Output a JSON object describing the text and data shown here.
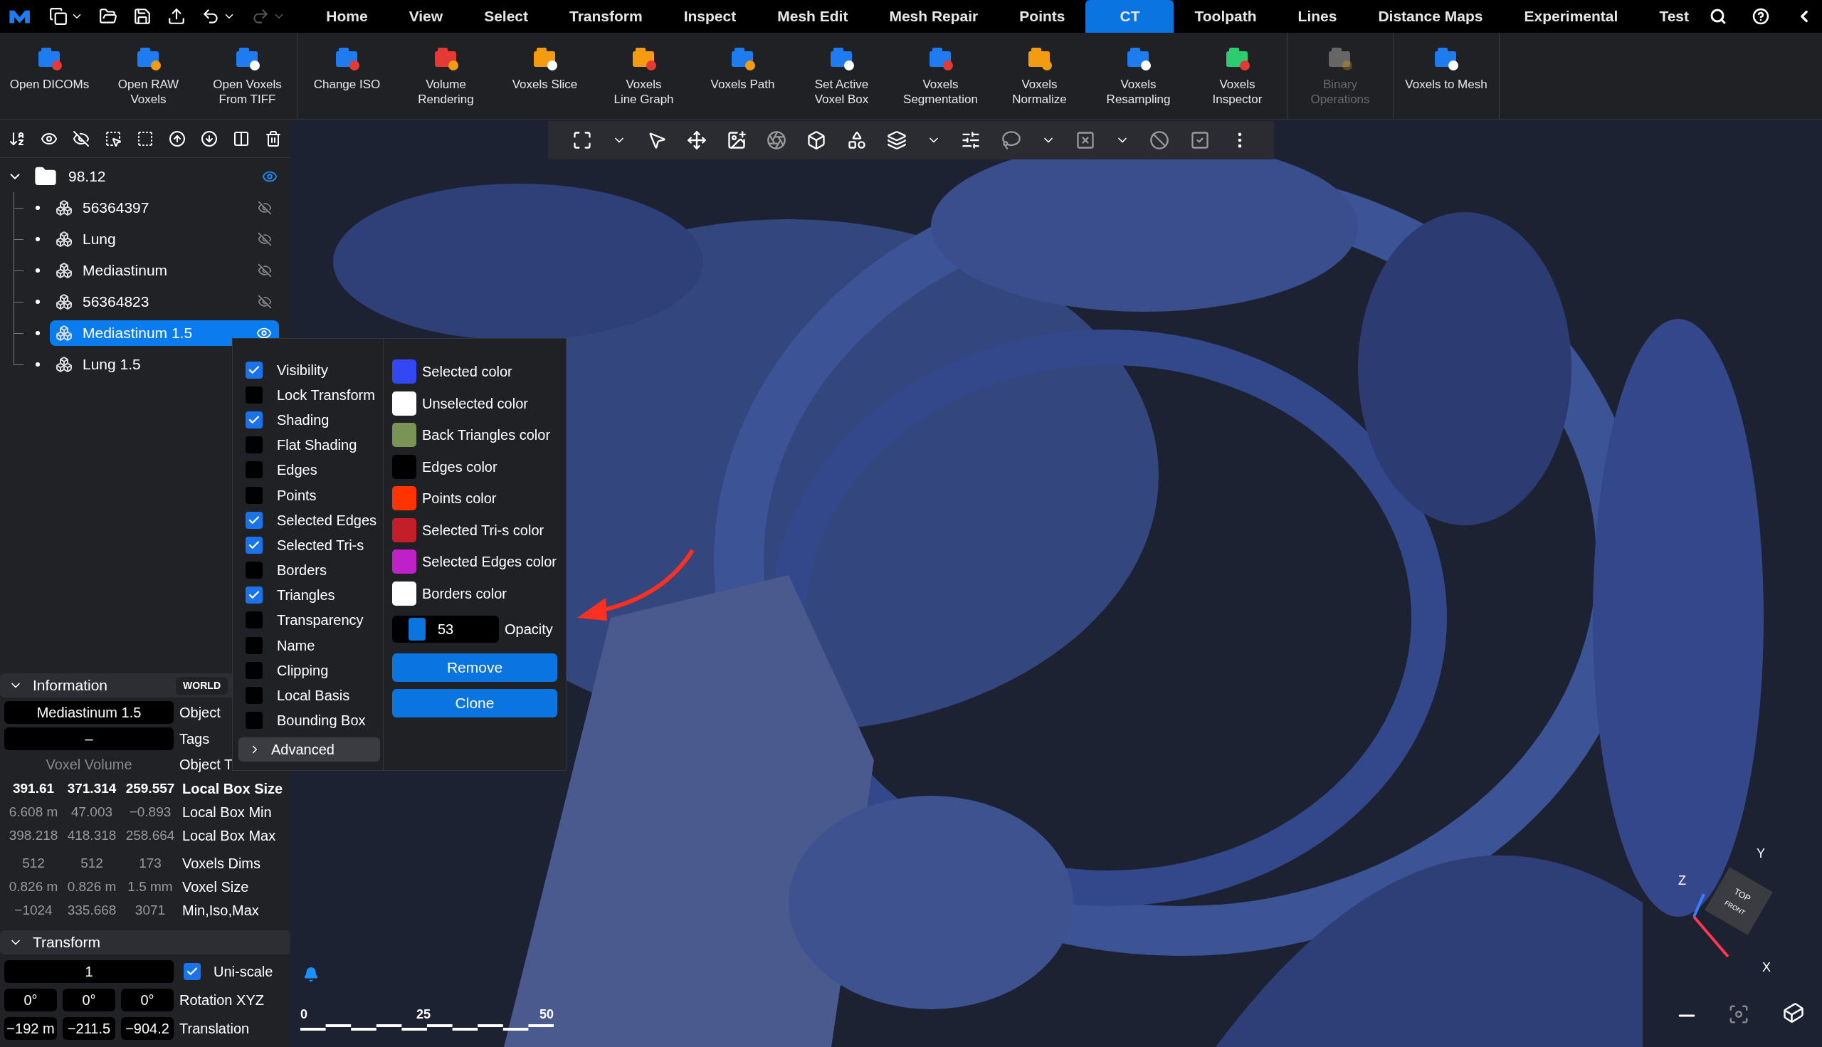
{
  "menu_bar": {
    "tabs": [
      {
        "label": "Home",
        "selected": false
      },
      {
        "label": "View",
        "selected": false
      },
      {
        "label": "Select",
        "selected": false
      },
      {
        "label": "Transform",
        "selected": false
      },
      {
        "label": "Inspect",
        "selected": false
      },
      {
        "label": "Mesh Edit",
        "selected": false
      },
      {
        "label": "Mesh Repair",
        "selected": false
      },
      {
        "label": "Points",
        "selected": false
      },
      {
        "label": "CT",
        "selected": true
      },
      {
        "label": "Toolpath",
        "selected": false
      },
      {
        "label": "Lines",
        "selected": false
      },
      {
        "label": "Distance Maps",
        "selected": false
      },
      {
        "label": "Experimental",
        "selected": false
      },
      {
        "label": "Test",
        "selected": false
      }
    ]
  },
  "ribbon": {
    "groups": [
      [
        {
          "label": "Open DICOMs",
          "disabled": false
        },
        {
          "label": "Open RAW\nVoxels",
          "disabled": false
        },
        {
          "label": "Open Voxels\nFrom TIFF",
          "disabled": false
        }
      ],
      [
        {
          "label": "Change ISO",
          "disabled": false
        },
        {
          "label": "Volume\nRendering",
          "disabled": false
        },
        {
          "label": "Voxels Slice",
          "disabled": false
        },
        {
          "label": "Voxels\nLine Graph",
          "disabled": false
        },
        {
          "label": "Voxels Path",
          "disabled": false
        },
        {
          "label": "Set Active\nVoxel Box",
          "disabled": false
        },
        {
          "label": "Voxels\nSegmentation",
          "disabled": false
        },
        {
          "label": "Voxels\nNormalize",
          "disabled": false
        },
        {
          "label": "Voxels\nResampling",
          "disabled": false
        },
        {
          "label": "Voxels\nInspector",
          "disabled": false
        }
      ],
      [
        {
          "label": "Binary\nOperations",
          "disabled": true
        }
      ],
      [
        {
          "label": "Voxels to Mesh",
          "disabled": false
        }
      ]
    ]
  },
  "scene_tree": {
    "label": "98.12",
    "expanded": true,
    "visible": true,
    "children": [
      {
        "label": "56364397",
        "visible": false,
        "selected": false
      },
      {
        "label": "Lung",
        "visible": false,
        "selected": false
      },
      {
        "label": "Mediastinum",
        "visible": false,
        "selected": false
      },
      {
        "label": "56364823",
        "visible": false,
        "selected": false
      },
      {
        "label": "Mediastinum 1.5",
        "visible": true,
        "selected": true
      },
      {
        "label": "Lung 1.5",
        "selected": false
      }
    ]
  },
  "context_menu": {
    "toggles": [
      {
        "label": "Visibility",
        "checked": true
      },
      {
        "label": "Lock Transform",
        "checked": false
      },
      {
        "label": "Shading",
        "checked": true
      },
      {
        "label": "Flat Shading",
        "checked": false
      },
      {
        "label": "Edges",
        "checked": false
      },
      {
        "label": "Points",
        "checked": false
      },
      {
        "label": "Selected Edges",
        "checked": true
      },
      {
        "label": "Selected Tri-s",
        "checked": true
      },
      {
        "label": "Borders",
        "checked": false
      },
      {
        "label": "Triangles",
        "checked": true
      },
      {
        "label": "Transparency",
        "checked": false
      },
      {
        "label": "Name",
        "checked": false
      },
      {
        "label": "Clipping",
        "checked": false
      },
      {
        "label": "Local Basis",
        "checked": false
      },
      {
        "label": "Bounding Box",
        "checked": false
      }
    ],
    "advanced": {
      "label": "Advanced",
      "expanded": false
    },
    "colors": [
      {
        "label": "Selected color",
        "color": "#3447f5"
      },
      {
        "label": "Unselected color",
        "color": "#ffffff"
      },
      {
        "label": "Back Triangles color",
        "color": "#7a9456"
      },
      {
        "label": "Edges color",
        "color": "#000000"
      },
      {
        "label": "Points color",
        "color": "#ff3300"
      },
      {
        "label": "Selected Tri-s color",
        "color": "#c41e2a"
      },
      {
        "label": "Selected Edges color",
        "color": "#c020c8"
      },
      {
        "label": "Borders color",
        "color": "#ffffff"
      }
    ],
    "opacity": {
      "value": "53",
      "label": "Opacity",
      "level": 0.18
    },
    "buttons": [
      "Remove",
      "Clone"
    ]
  },
  "information": {
    "title": "Information",
    "expanded": true,
    "badge": "WORLD",
    "fields": [
      {
        "value": "Mediastinum 1.5",
        "label": "Object"
      },
      {
        "value": "–",
        "label": "Tags"
      }
    ],
    "object_type": {
      "value": "Voxel Volume",
      "label": "Object T"
    },
    "rows": [
      {
        "values": [
          "391.61",
          "371.314",
          "259.557"
        ],
        "label": "Local Box Size",
        "kind": "bold"
      },
      {
        "values": [
          "6.608 m",
          "47.003",
          "−0.893"
        ],
        "label": "Local Box Min",
        "kind": "plain"
      },
      {
        "values": [
          "398.218",
          "418.318",
          "258.664"
        ],
        "label": "Local Box Max",
        "kind": "plain"
      },
      {
        "values": [
          "512",
          "512",
          "173"
        ],
        "label": "Voxels Dims",
        "kind": "plain"
      },
      {
        "values": [
          "0.826 m",
          "0.826 m",
          "1.5 mm"
        ],
        "label": "Voxel Size",
        "kind": "plain"
      },
      {
        "values": [
          "−1024",
          "335.668",
          "3071"
        ],
        "label": "Min,Iso,Max",
        "kind": "plain"
      }
    ]
  },
  "transform": {
    "title": "Transform",
    "expanded": true,
    "scale": "1",
    "uniscale": {
      "label": "Uni-scale",
      "checked": true
    },
    "rotation": {
      "values": [
        "0°",
        "0°",
        "0°"
      ],
      "label": "Rotation XYZ"
    },
    "translation": {
      "values": [
        "−192 m",
        "−211.5",
        "−904.2"
      ],
      "label": "Translation"
    }
  },
  "viewport": {
    "scale_labels": [
      "0",
      "25",
      "50"
    ],
    "axes": {
      "y": "Y",
      "z": "Z",
      "x": "X"
    },
    "cube": {
      "top": "TOP",
      "front": "FRONT"
    }
  }
}
